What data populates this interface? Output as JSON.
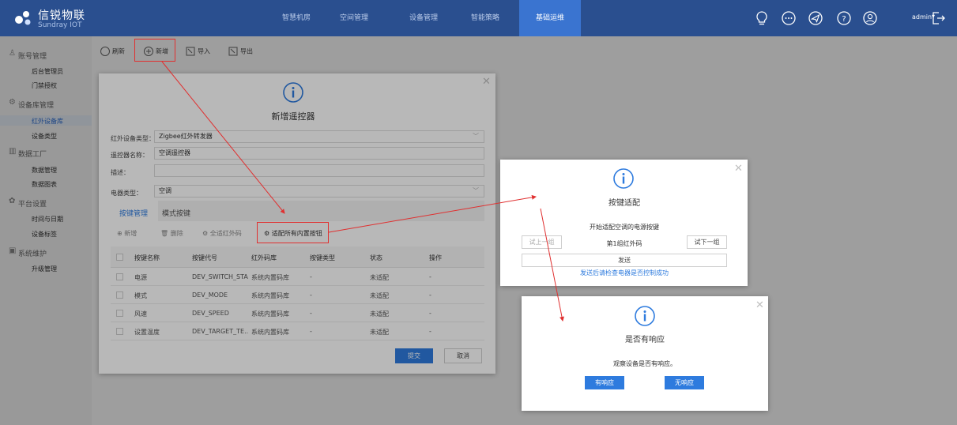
{
  "app": {
    "logo_main": "信锐物联",
    "logo_sub": "Sundray IOT",
    "nav": [
      "智慧机房",
      "空间管理",
      "设备管理",
      "智能策略",
      "基础运维"
    ],
    "admin": "admin"
  },
  "sidebar": {
    "groups": [
      {
        "label": "账号管理",
        "items": [
          "后台管理员",
          "门禁授权"
        ]
      },
      {
        "label": "设备库管理",
        "items": [
          "红外设备库",
          "设备类型"
        ]
      },
      {
        "label": "数据工厂",
        "items": [
          "数据管理",
          "数据图表"
        ]
      },
      {
        "label": "平台设置",
        "items": [
          "时间与日期",
          "设备标签"
        ]
      },
      {
        "label": "系统维护",
        "items": [
          "升级管理"
        ]
      }
    ]
  },
  "toolbar": {
    "refresh": "刷新",
    "add": "新增",
    "import": "导入",
    "export": "导出"
  },
  "main_modal": {
    "title": "新增遥控器",
    "fields": [
      {
        "label": "红外设备类型：",
        "value": "Zigbee红外转发器"
      },
      {
        "label": "遥控器名称：",
        "value": "空调遥控器"
      },
      {
        "label": "描述：",
        "value": ""
      },
      {
        "label": "电器类型：",
        "value": "空调"
      }
    ],
    "tabs": [
      "按键管理",
      "模式按键"
    ],
    "actions": {
      "add": "新增",
      "delete": "删除",
      "adapt_ir": "全适红外码",
      "adapt_all": "适配所有内置按钮"
    },
    "columns": [
      "按键名称",
      "按键代号",
      "红外码库",
      "按键类型",
      "状态",
      "操作"
    ],
    "rows": [
      [
        "电源",
        "DEV_SWITCH_STA",
        "系统内置码库",
        "-",
        "未适配",
        "-"
      ],
      [
        "模式",
        "DEV_MODE",
        "系统内置码库",
        "-",
        "未适配",
        "-"
      ],
      [
        "风速",
        "DEV_SPEED",
        "系统内置码库",
        "-",
        "未适配",
        "-"
      ],
      [
        "设置温度",
        "DEV_TARGET_TE...",
        "系统内置码库",
        "-",
        "未适配",
        "-"
      ]
    ],
    "submit": "提交",
    "cancel": "取消"
  },
  "adapt_modal": {
    "title": "按键适配",
    "hint": "开始适配空调的电源按键",
    "prev": "试上一组",
    "group": "第1组红外码",
    "next": "试下一组",
    "send": "发送",
    "check": "发送后请检查电器是否控制成功"
  },
  "response_modal": {
    "title": "是否有响应",
    "message": "观察设备是否有响应。",
    "yes": "有响应",
    "no": "无响应"
  },
  "colors": {
    "accent": "#2e7bde",
    "topbar": "#2a4f8f",
    "annotation": "#e03030"
  }
}
